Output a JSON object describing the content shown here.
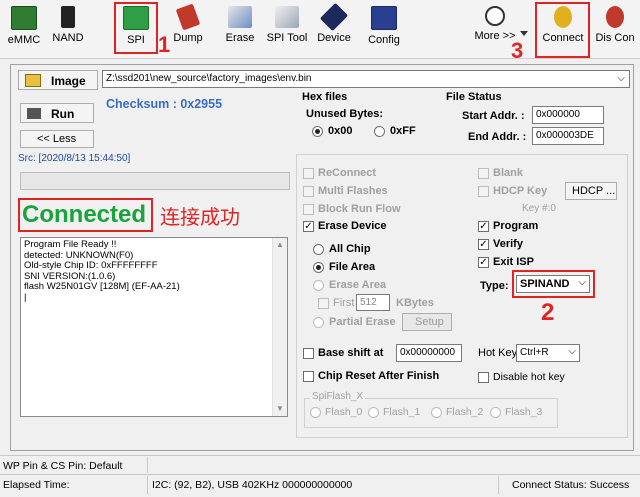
{
  "toolbar": {
    "items": [
      {
        "label": "eMMC"
      },
      {
        "label": "NAND"
      },
      {
        "label": "SPI"
      },
      {
        "label": "Dump"
      },
      {
        "label": "Erase"
      },
      {
        "label": "SPI Tool"
      },
      {
        "label": "Device"
      },
      {
        "label": "Config"
      },
      {
        "label": "More >>"
      },
      {
        "label": "Connect"
      },
      {
        "label": "Dis Con"
      }
    ]
  },
  "annotations": {
    "num1": "1",
    "num2": "2",
    "num3": "3",
    "connected_cn": "连接成功",
    "accent_color": "#e02424"
  },
  "image_row": {
    "image_button": "Image",
    "path": "Z:\\ssd201\\new_source\\factory_images\\env.bin"
  },
  "left": {
    "run_button": "Run",
    "checksum": "Checksum : 0x2955",
    "less_button": "<< Less",
    "src": "Src: [2020/8/13 15:44:50]",
    "connected": "Connected",
    "log": [
      "Program File Ready !!",
      "detected: UNKNOWN(F0)",
      "Old-style Chip ID: 0xFFFFFFFF",
      "SNI VERSION:(1.0.6)",
      "flash W25N01GV [128M] (EF-AA-21)",
      "|"
    ]
  },
  "hex": {
    "title": "Hex files",
    "unused": "Unused Bytes:",
    "opt1": "0x00",
    "opt2": "0xFF"
  },
  "file_status": {
    "title": "File Status",
    "start_label": "Start Addr. :",
    "start_value": "0x000000",
    "end_label": "End Addr. :",
    "end_value": "0x000003DE"
  },
  "options": {
    "reconnect": "ReConnect",
    "multi": "Multi Flashes",
    "block_run": "Block Run Flow",
    "erase_device": "Erase Device",
    "all_chip": "All Chip",
    "file_area": "File Area",
    "erase_area": "Erase Area",
    "first": "First",
    "first_value": "512",
    "kbytes": "KBytes",
    "partial": "Partial Erase",
    "setup": "Setup",
    "blank": "Blank",
    "hdcp_key": "HDCP Key",
    "hdcp_btn": "HDCP ...",
    "key_no": "Key #:0",
    "program": "Program",
    "verify": "Verify",
    "exit_isp": "Exit ISP",
    "type_label": "Type:",
    "type_value": "SPINAND",
    "base_shift": "Base shift at",
    "base_value": "0x00000000",
    "hot_key": "Hot Key",
    "hot_key_value": "Ctrl+R",
    "chip_reset": "Chip Reset After Finish",
    "disable_hot": "Disable hot key",
    "spiflash_group": "SpiFlash_X",
    "flash0": "Flash_0",
    "flash1": "Flash_1",
    "flash2": "Flash_2",
    "flash3": "Flash_3"
  },
  "status": {
    "wp_pin": "WP Pin & CS Pin: Default",
    "elapsed": "Elapsed Time:",
    "i2c": "I2C: (92, B2), USB  402KHz  000000000000",
    "connect_status": "Connect Status: Success"
  }
}
